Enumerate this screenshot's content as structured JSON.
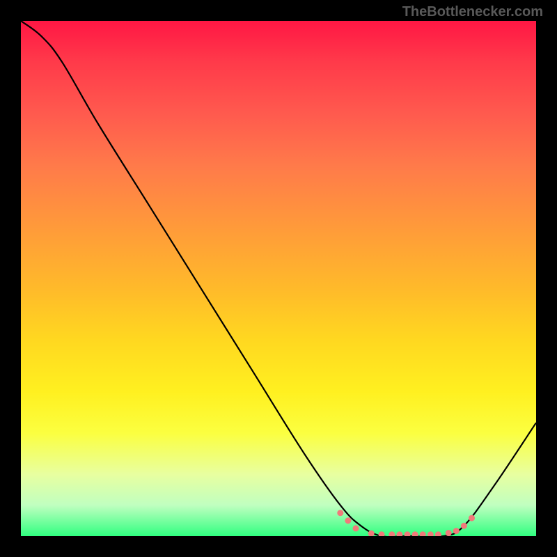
{
  "watermark": "TheBottlenecker.com",
  "chart_data": {
    "type": "line",
    "title": "",
    "xlabel": "",
    "ylabel": "",
    "xlim": [
      0,
      100
    ],
    "ylim": [
      0,
      100
    ],
    "grid": false,
    "legend": false,
    "curve": [
      {
        "x": 0,
        "y": 100
      },
      {
        "x": 4,
        "y": 97
      },
      {
        "x": 8,
        "y": 92
      },
      {
        "x": 15,
        "y": 80
      },
      {
        "x": 25,
        "y": 64
      },
      {
        "x": 35,
        "y": 48
      },
      {
        "x": 45,
        "y": 32
      },
      {
        "x": 55,
        "y": 16
      },
      {
        "x": 62,
        "y": 6
      },
      {
        "x": 66,
        "y": 2
      },
      {
        "x": 70,
        "y": 0
      },
      {
        "x": 75,
        "y": 0
      },
      {
        "x": 82,
        "y": 0
      },
      {
        "x": 86,
        "y": 2
      },
      {
        "x": 92,
        "y": 10
      },
      {
        "x": 100,
        "y": 22
      }
    ],
    "markers": [
      {
        "x": 62,
        "y": 4.5
      },
      {
        "x": 63.5,
        "y": 3
      },
      {
        "x": 65,
        "y": 1.5
      },
      {
        "x": 68,
        "y": 0.5
      },
      {
        "x": 70,
        "y": 0.3
      },
      {
        "x": 72,
        "y": 0.3
      },
      {
        "x": 73.5,
        "y": 0.3
      },
      {
        "x": 75,
        "y": 0.3
      },
      {
        "x": 76.5,
        "y": 0.3
      },
      {
        "x": 78,
        "y": 0.3
      },
      {
        "x": 79.5,
        "y": 0.3
      },
      {
        "x": 81,
        "y": 0.3
      },
      {
        "x": 83,
        "y": 0.6
      },
      {
        "x": 84.5,
        "y": 1
      },
      {
        "x": 86,
        "y": 2
      },
      {
        "x": 87.5,
        "y": 3.5
      }
    ],
    "curve_color": "#000000",
    "marker_color": "#f07a7a",
    "gradient": {
      "top": "#ff1744",
      "upper_mid": "#ff9a3a",
      "mid": "#fff020",
      "lower_mid": "#e8ffa0",
      "bottom": "#30ff80"
    }
  }
}
